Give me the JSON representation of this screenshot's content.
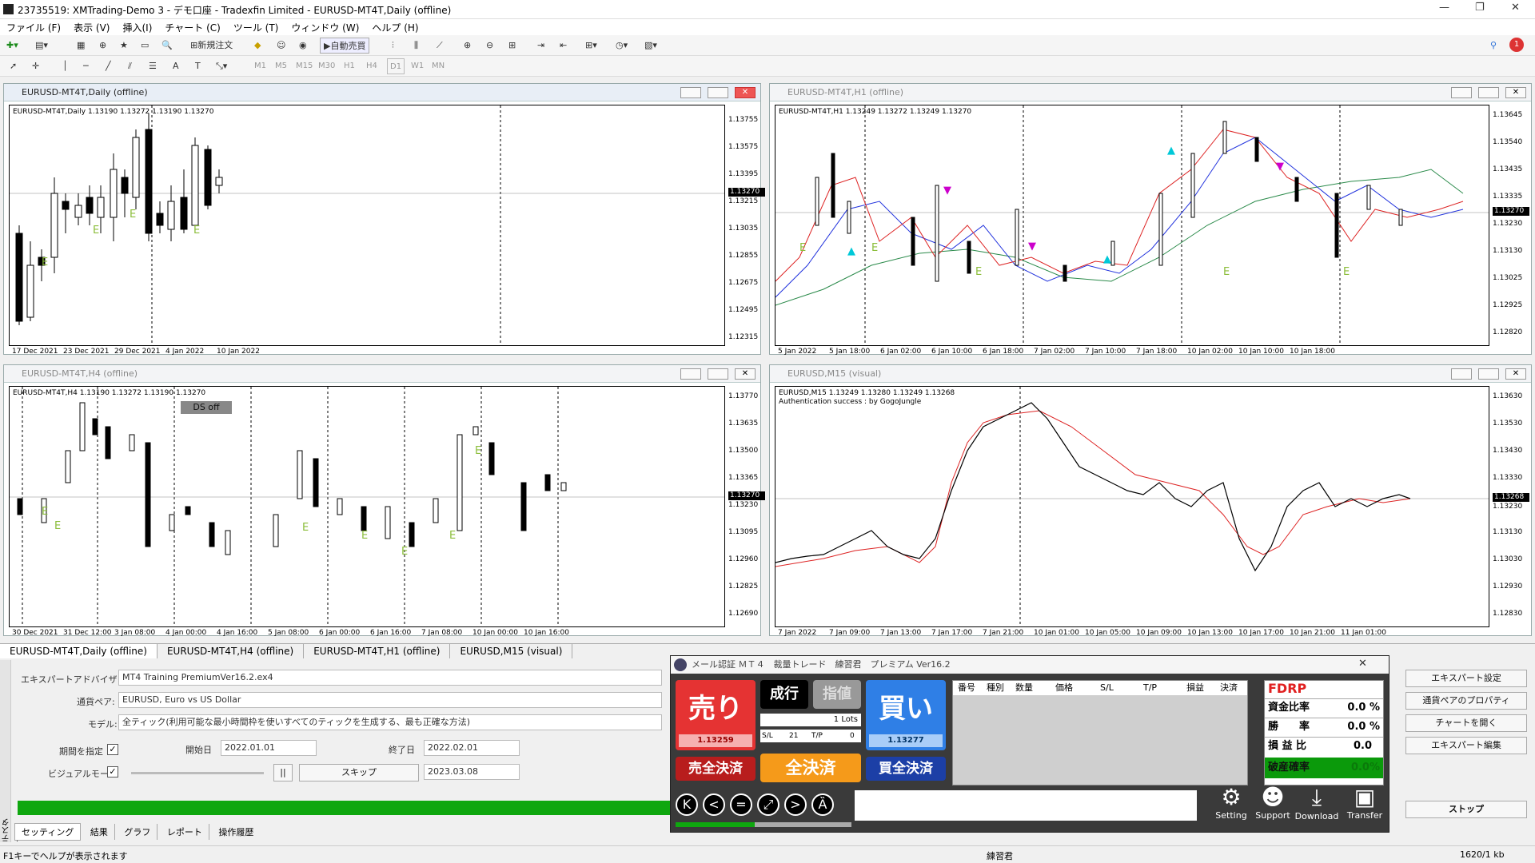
{
  "window": {
    "title": "23735519: XMTrading-Demo 3 - デモ口座 - Tradexfin Limited - EURUSD-MT4T,Daily (offline)",
    "min": "—",
    "max": "❐",
    "close": "✕"
  },
  "menu": [
    "ファイル (F)",
    "表示 (V)",
    "挿入(I)",
    "チャート (C)",
    "ツール (T)",
    "ウィンドウ (W)",
    "ヘルプ (H)"
  ],
  "toolbar": {
    "new_order": "新規注文",
    "auto_trade": "自動売買",
    "notif_count": "1"
  },
  "timeframes": [
    "M1",
    "M5",
    "M15",
    "M30",
    "H1",
    "H4",
    "D1",
    "W1",
    "MN"
  ],
  "charts": [
    {
      "title": "EURUSD-MT4T,Daily (offline)",
      "info": "EURUSD-MT4T,Daily  1.13190 1.13272 1.13190 1.13270",
      "prices": [
        "1.13755",
        "1.13575",
        "1.13395",
        "1.13215",
        "1.13035",
        "1.12855",
        "1.12675",
        "1.12495",
        "1.12315"
      ],
      "current": "1.13270",
      "times": [
        "17 Dec 2021",
        "23 Dec 2021",
        "29 Dec 2021",
        "4 Jan 2022",
        "10 Jan 2022"
      ]
    },
    {
      "title": "EURUSD-MT4T,H1 (offline)",
      "info": "EURUSD-MT4T,H1  1.13249 1.13272 1.13249 1.13270",
      "prices": [
        "1.13645",
        "1.13540",
        "1.13435",
        "1.13335",
        "1.13230",
        "1.13130",
        "1.13025",
        "1.12925",
        "1.12820"
      ],
      "current": "1.13270",
      "times": [
        "5 Jan 2022",
        "5 Jan 18:00",
        "6 Jan 02:00",
        "6 Jan 10:00",
        "6 Jan 18:00",
        "7 Jan 02:00",
        "7 Jan 10:00",
        "7 Jan 18:00",
        "10 Jan 02:00",
        "10 Jan 10:00",
        "10 Jan 18:00"
      ]
    },
    {
      "title": "EURUSD-MT4T,H4 (offline)",
      "info": "EURUSD-MT4T,H4  1.13190 1.13272 1.13190 1.13270",
      "prices": [
        "1.13770",
        "1.13635",
        "1.13500",
        "1.13365",
        "1.13230",
        "1.13095",
        "1.12960",
        "1.12825",
        "1.12690"
      ],
      "current": "1.13270",
      "times": [
        "30 Dec 2021",
        "31 Dec 12:00",
        "3 Jan 08:00",
        "4 Jan 00:00",
        "4 Jan 16:00",
        "5 Jan 08:00",
        "6 Jan 00:00",
        "6 Jan 16:00",
        "7 Jan 08:00",
        "10 Jan 00:00",
        "10 Jan 16:00"
      ],
      "ds_label": "DS off"
    },
    {
      "title": "EURUSD,M15 (visual)",
      "info": "EURUSD,M15  1.13249 1.13280 1.13249 1.13268",
      "auth": "Authentication success : by GogoJungle",
      "prices": [
        "1.13630",
        "1.13530",
        "1.13430",
        "1.13330",
        "1.13230",
        "1.13130",
        "1.13030",
        "1.12930",
        "1.12830"
      ],
      "current": "1.13268",
      "times": [
        "7 Jan 2022",
        "7 Jan 09:00",
        "7 Jan 13:00",
        "7 Jan 17:00",
        "7 Jan 21:00",
        "10 Jan 01:00",
        "10 Jan 05:00",
        "10 Jan 09:00",
        "10 Jan 13:00",
        "10 Jan 17:00",
        "10 Jan 21:00",
        "11 Jan 01:00"
      ]
    }
  ],
  "chart_tabs": [
    "EURUSD-MT4T,Daily (offline)",
    "EURUSD-MT4T,H4 (offline)",
    "EURUSD-MT4T,H1 (offline)",
    "EURUSD,M15 (visual)"
  ],
  "tester": {
    "ea_label": "エキスパートアドバイザ",
    "ea_value": "MT4 Training PremiumVer16.2.ex4",
    "symbol_label": "通貨ペア:",
    "symbol_value": "EURUSD, Euro vs US Dollar",
    "model_label": "モデル:",
    "model_value": "全ティック(利用可能な最小時間枠を使いすべてのティックを生成する、最も正確な方法)",
    "period_label": "期間を指定",
    "start_label": "開始日",
    "start_value": "2022.01.01",
    "end_label": "終了日",
    "end_value": "2022.02.01",
    "visual_label": "ビジュアルモード",
    "skip_label": "スキップ",
    "skip_date": "2023.03.08",
    "pause": "||",
    "right_buttons": [
      "エキスパート設定",
      "通貨ペアのプロパティ",
      "チャートを開く",
      "エキスパート編集"
    ],
    "stop": "ストップ",
    "tabs": [
      "セッティング",
      "結果",
      "グラフ",
      "レポート",
      "操作履歴"
    ],
    "side_label": "テスター"
  },
  "panel": {
    "title": "メール認証 ＭＴ４　裁量トレード　練習君　プレミアム Ver16.2",
    "sell": "売り",
    "sell_price": "1.13259",
    "buy": "買い",
    "buy_price": "1.13277",
    "market": "成行",
    "limit": "指値",
    "lots_value": "1",
    "lots_unit": "Lots",
    "sl_label": "S/L",
    "sl_value": "21",
    "tp_label": "T/P",
    "tp_value": "0",
    "close_sell": "売全決済",
    "close_all": "全決済",
    "close_buy": "買全決済",
    "cols": [
      "番号",
      "種別",
      "数量",
      "価格",
      "S/L",
      "T/P",
      "損益",
      "決済"
    ],
    "fdrp": "FDRP",
    "stats": [
      {
        "label": "資金比率",
        "value": "0.0 %"
      },
      {
        "label": "勝　　率",
        "value": "0.0 %"
      },
      {
        "label": "損 益 比",
        "value": "0.0"
      },
      {
        "label": "破産確率",
        "value": "0.0%"
      }
    ],
    "nav": [
      "K",
      "<",
      "=",
      "⤢",
      ">",
      "Ȁ"
    ],
    "icons": [
      "Setting",
      "Support",
      "Download",
      "Transfer"
    ]
  },
  "status": {
    "help": "F1キーでヘルプが表示されます",
    "mode": "練習君",
    "bar": "1620/1 kb"
  }
}
